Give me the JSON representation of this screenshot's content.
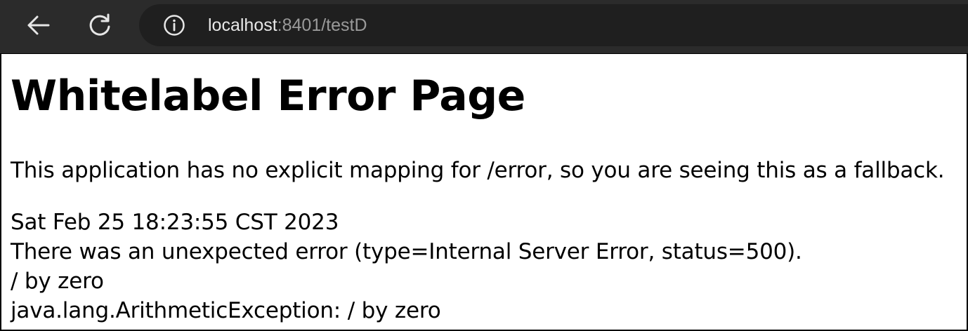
{
  "browser": {
    "address": {
      "host": "localhost",
      "rest": ":8401/testD"
    },
    "icons": {
      "back": "arrow-left-icon",
      "reload": "reload-icon",
      "site_info": "info-icon"
    }
  },
  "page": {
    "title": "Whitelabel Error Page",
    "explanation": "This application has no explicit mapping for /error, so you are seeing this as a fallback.",
    "timestamp": "Sat Feb 25 18:23:55 CST 2023",
    "error_summary": "There was an unexpected error (type=Internal Server Error, status=500).",
    "message": "/ by zero",
    "exception": "java.lang.ArithmeticException: / by zero"
  }
}
